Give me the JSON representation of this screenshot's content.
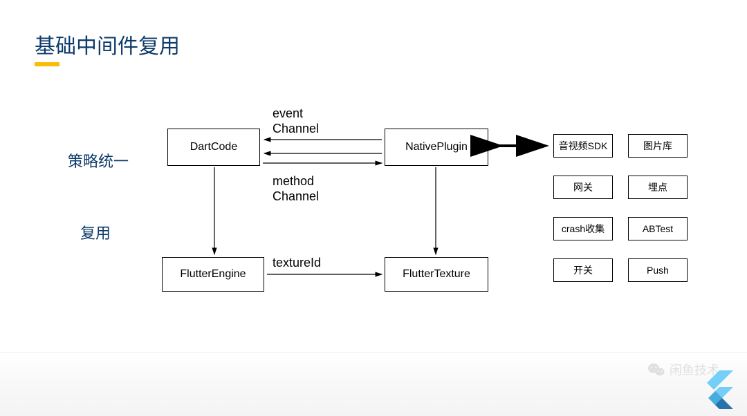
{
  "title": "基础中间件复用",
  "labels": {
    "strategy": "策略统一",
    "reuse": "复用"
  },
  "nodes": {
    "dartcode": "DartCode",
    "nativeplugin": "NativePlugin",
    "flutterengine": "FlutterEngine",
    "fluttertexture": "FlutterTexture"
  },
  "annotations": {
    "event_l1": "event",
    "event_l2": "Channel",
    "method_l1": "method",
    "method_l2": "Channel",
    "textureid": "textureId"
  },
  "services": {
    "r1c1": "音视频SDK",
    "r1c2": "图片库",
    "r2c1": "网关",
    "r2c2": "埋点",
    "r3c1": "crash收集",
    "r3c2": "ABTest",
    "r4c1": "开关",
    "r4c2": "Push"
  },
  "footer": {
    "brand": "闲鱼技术"
  }
}
